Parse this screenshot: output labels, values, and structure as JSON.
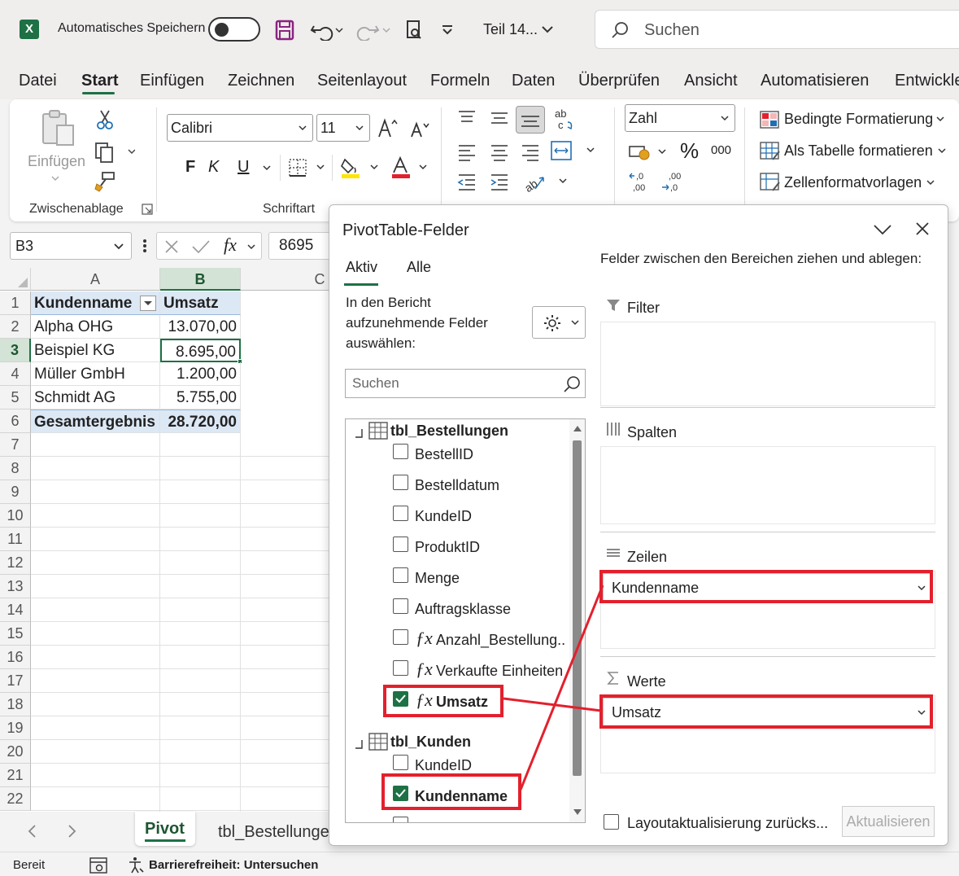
{
  "titlebar": {
    "autosave_label": "Automatisches Speichern",
    "file_name": "Teil 14...",
    "search_placeholder": "Suchen"
  },
  "menu": {
    "items": [
      "Datei",
      "Start",
      "Einfügen",
      "Zeichnen",
      "Seitenlayout",
      "Formeln",
      "Daten",
      "Überprüfen",
      "Ansicht",
      "Automatisieren",
      "Entwickle"
    ],
    "active": "Start"
  },
  "ribbon": {
    "clipboard": {
      "paste_label": "Einfügen",
      "group_label": "Zwischenablage"
    },
    "font": {
      "name": "Calibri",
      "size": "11",
      "bold": "F",
      "italic": "K",
      "underline": "U",
      "group_label": "Schriftart"
    },
    "number": {
      "format": "Zahl",
      "percent": "%",
      "thousands": "000"
    },
    "styles": {
      "conditional": "Bedingte Formatierung",
      "as_table": "Als Tabelle formatieren",
      "cell_styles": "Zellenformatvorlagen"
    }
  },
  "formula_bar": {
    "name_box": "B3",
    "fx": "fx",
    "value": "8695"
  },
  "grid": {
    "columns": [
      "A",
      "B",
      "C"
    ],
    "rows": [
      "1",
      "2",
      "3",
      "4",
      "5",
      "6",
      "7",
      "8",
      "9",
      "10",
      "11",
      "12",
      "13",
      "14",
      "15",
      "16",
      "17",
      "18",
      "19",
      "20",
      "21",
      "22"
    ],
    "header": {
      "col_a": "Kundenname",
      "col_b": "Umsatz"
    },
    "data": [
      {
        "name": "Alpha OHG",
        "value": "13.070,00"
      },
      {
        "name": "Beispiel KG",
        "value": "8.695,00"
      },
      {
        "name": "Müller GmbH",
        "value": "1.200,00"
      },
      {
        "name": "Schmidt AG",
        "value": "5.755,00"
      }
    ],
    "total": {
      "name": "Gesamtergebnis",
      "value": "28.720,00"
    }
  },
  "sheet_tabs": [
    "Pivot",
    "tbl_Bestellunge"
  ],
  "status": {
    "ready": "Bereit",
    "accessibility": "Barrierefreiheit: Untersuchen"
  },
  "pivot": {
    "title": "PivotTable-Felder",
    "tabs": [
      "Aktiv",
      "Alle"
    ],
    "instructions": [
      "In den Bericht",
      "aufzunehmende Felder",
      "auswählen:"
    ],
    "drag_hint": "Felder zwischen den Bereichen ziehen und ablegen:",
    "search_placeholder": "Suchen",
    "table1": {
      "name": "tbl_Bestellungen",
      "fields": [
        "BestellID",
        "Bestelldatum",
        "KundeID",
        "ProduktID",
        "Menge",
        "Auftragsklasse",
        "Anzahl_Bestellung...",
        "Verkaufte Einheiten",
        "Umsatz"
      ]
    },
    "table2": {
      "name": "tbl_Kunden",
      "fields": [
        "KundeID",
        "Kundenname"
      ]
    },
    "areas": {
      "filter": "Filter",
      "columns": "Spalten",
      "rows": "Zeilen",
      "values": "Werte",
      "rows_field": "Kundenname",
      "values_field": "Umsatz"
    },
    "defer_label": "Layoutaktualisierung zurücks...",
    "update_button": "Aktualisieren"
  },
  "colors": {
    "excel_green": "#1e7145",
    "highlight_red": "#e3202d",
    "pivot_header_blue": "#dde8f5"
  }
}
